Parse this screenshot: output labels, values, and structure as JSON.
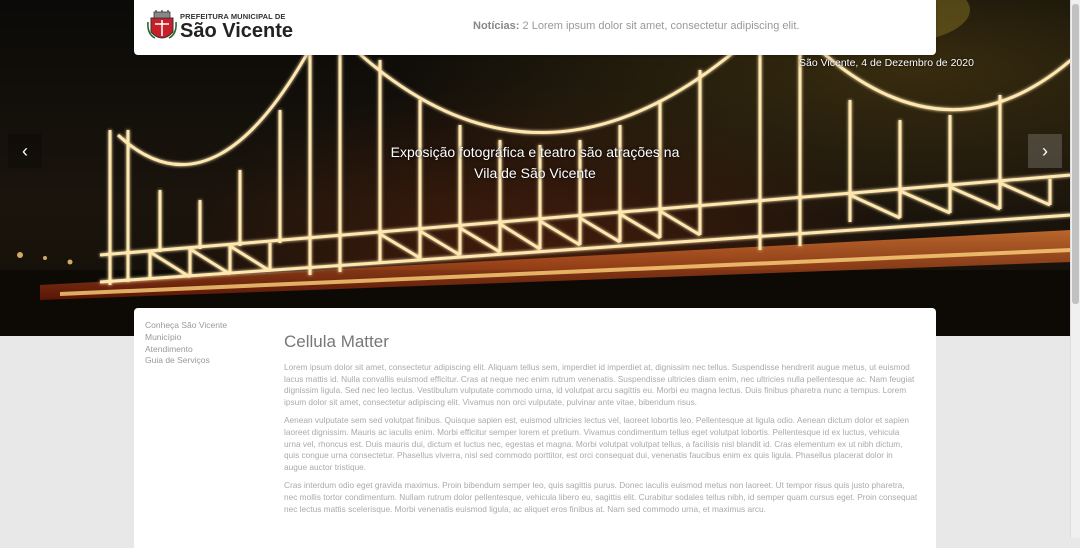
{
  "header": {
    "logo_small": "PREFEITURA MUNICIPAL DE",
    "logo_big": "São Vicente",
    "news_label": "Notícias:",
    "news_text": "2 Lorem ipsum dolor sit amet, consectetur adipiscing elit."
  },
  "hero": {
    "date": "São Vicente, 4 de Dezembro de 2020",
    "caption_line1": "Exposição fotográfica e teatro são atrações na",
    "caption_line2": "Vila de São Vicente",
    "prev_icon": "‹",
    "next_icon": "›"
  },
  "sidebar": {
    "items": [
      {
        "label": "Conheça São Vicente"
      },
      {
        "label": "Município"
      },
      {
        "label": "Atendimento"
      },
      {
        "label": "Guia de Serviços"
      }
    ]
  },
  "article": {
    "title": "Cellula Matter",
    "paragraphs": [
      "Lorem ipsum dolor sit amet, consectetur adipiscing elit. Aliquam tellus sem, imperdiet id imperdiet at, dignissim nec tellus. Suspendisse hendrerit augue metus, ut euismod lacus mattis id. Nulla convallis euismod efficitur. Cras at neque nec enim rutrum venenatis. Suspendisse ultricies diam enim, nec ultricies nulla pellentesque ac. Nam feugiat dignissim ligula. Sed nec leo lectus. Vestibulum vulputate commodo urna, id volutpat arcu sagittis eu. Morbi eu magna lectus. Duis finibus pharetra nunc a tempus. Lorem ipsum dolor sit amet, consectetur adipiscing elit. Vivamus non orci vulputate, pulvinar ante vitae, bibendum risus.",
      "Aenean vulputate sem sed volutpat finibus. Quisque sapien est, euismod ultricies lectus vel, laoreet lobortis leo. Pellentesque at ligula odio. Aenean dictum dolor et sapien laoreet dignissim. Mauris ac iaculis enim. Morbi efficitur semper lorem et pretium. Vivamus condimentum tellus eget volutpat lobortis. Pellentesque id ex luctus, vehicula urna vel, rhoncus est. Duis mauris dui, dictum et luctus nec, egestas et magna. Morbi volutpat volutpat tellus, a facilisis nisl blandit id. Cras elementum ex ut nibh dictum, quis congue urna consectetur. Phasellus viverra, nisl sed commodo porttitor, est orci consequat dui, venenatis faucibus enim ex quis ligula. Phasellus placerat dolor in augue auctor tristique.",
      "Cras interdum odio eget gravida maximus. Proin bibendum semper leo, quis sagittis purus. Donec iaculis euismod metus non laoreet. Ut tempor risus quis justo pharetra, nec mollis tortor condimentum. Nullam rutrum dolor pellentesque, vehicula libero eu, sagittis elit. Curabitur sodales tellus nibh, id semper quam cursus eget. Proin consequat nec lectus mattis scelerisque. Morbi venenatis euismod ligula, ac aliquet eros finibus at. Nam sed commodo urna, et maximus arcu."
    ]
  }
}
